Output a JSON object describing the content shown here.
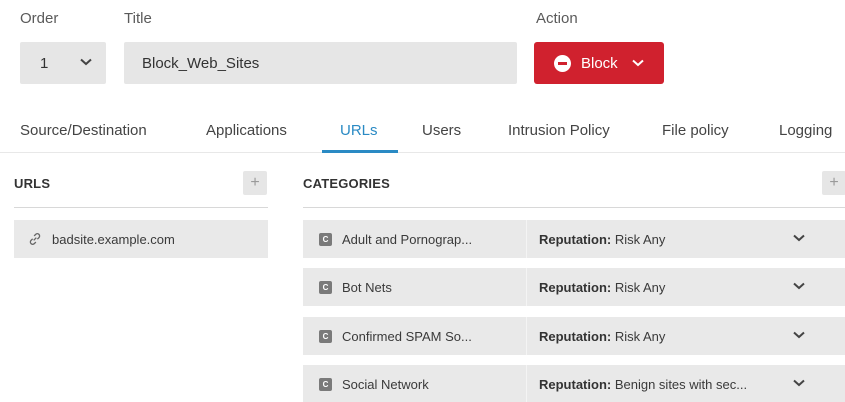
{
  "labels": {
    "order": "Order",
    "title": "Title",
    "action": "Action"
  },
  "order": {
    "value": "1"
  },
  "title": {
    "value": "Block_Web_Sites"
  },
  "action": {
    "label": "Block",
    "color": "#d0212e"
  },
  "tabs": [
    {
      "label": "Source/Destination"
    },
    {
      "label": "Applications"
    },
    {
      "label": "URLs",
      "active": true
    },
    {
      "label": "Users"
    },
    {
      "label": "Intrusion Policy"
    },
    {
      "label": "File policy"
    },
    {
      "label": "Logging"
    }
  ],
  "urls": {
    "header": "URLS",
    "add_icon": "plus-icon",
    "items": [
      {
        "text": "badsite.example.com",
        "icon": "link-icon"
      }
    ]
  },
  "categories": {
    "header": "CATEGORIES",
    "add_icon": "plus-icon",
    "badge": "C",
    "rep_label": "Reputation:",
    "items": [
      {
        "name": "Adult and Pornograp...",
        "reputation": "Risk Any"
      },
      {
        "name": "Bot Nets",
        "reputation": "Risk Any"
      },
      {
        "name": "Confirmed SPAM So...",
        "reputation": "Risk Any"
      },
      {
        "name": "Social Network",
        "reputation": "Benign sites with sec..."
      }
    ]
  },
  "colors": {
    "accent": "#2a8ac4",
    "block": "#d0212e",
    "field_bg": "#e6e6e6"
  }
}
